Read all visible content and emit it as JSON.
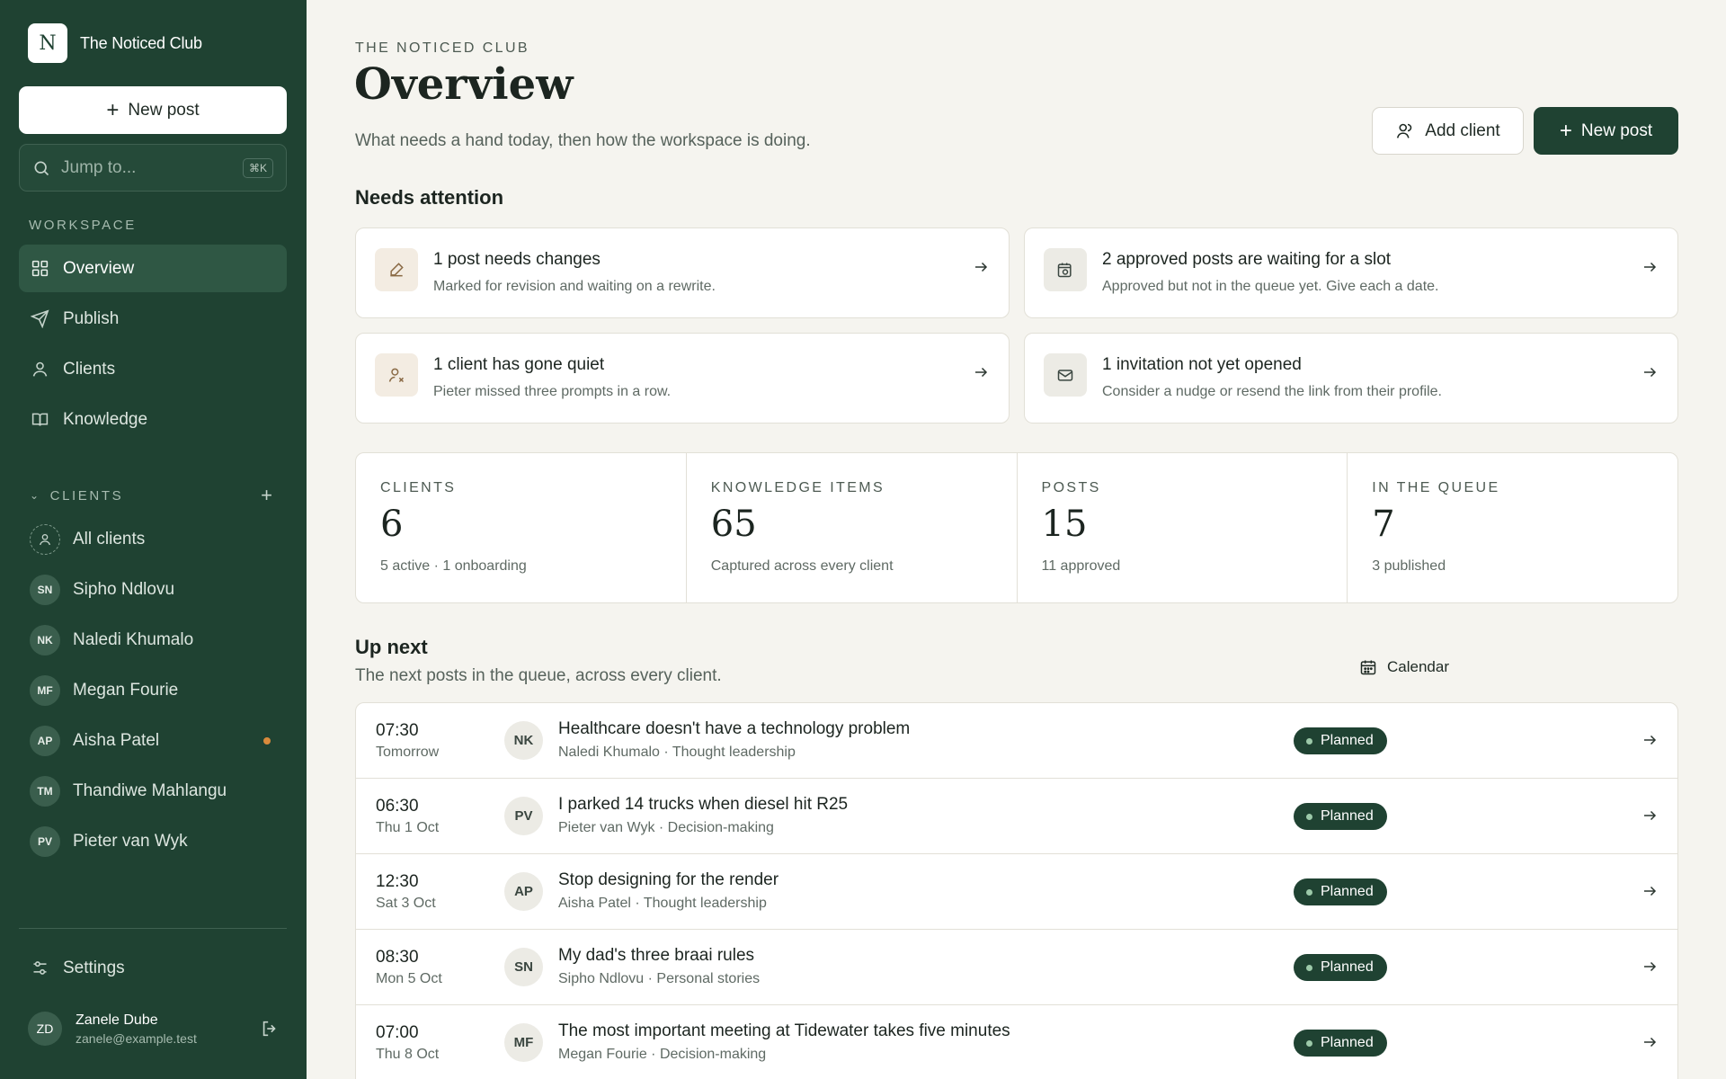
{
  "brand": {
    "initial": "N",
    "name": "The Noticed Club"
  },
  "sidebar": {
    "new_post_label": "New post",
    "search_placeholder": "Jump to...",
    "search_shortcut": "⌘K",
    "workspace_heading": "WORKSPACE",
    "nav": [
      {
        "label": "Overview",
        "icon": "grid-icon",
        "active": true
      },
      {
        "label": "Publish",
        "icon": "send-icon"
      },
      {
        "label": "Clients",
        "icon": "user-icon"
      },
      {
        "label": "Knowledge",
        "icon": "book-icon"
      }
    ],
    "clients_heading": "CLIENTS",
    "clients": [
      {
        "initials": "",
        "name": "All clients"
      },
      {
        "initials": "SN",
        "name": "Sipho Ndlovu"
      },
      {
        "initials": "NK",
        "name": "Naledi Khumalo"
      },
      {
        "initials": "MF",
        "name": "Megan Fourie"
      },
      {
        "initials": "AP",
        "name": "Aisha Patel",
        "flag": true
      },
      {
        "initials": "TM",
        "name": "Thandiwe Mahlangu"
      },
      {
        "initials": "PV",
        "name": "Pieter van Wyk"
      }
    ],
    "settings_label": "Settings",
    "user": {
      "initials": "ZD",
      "name": "Zanele Dube",
      "email": "zanele@example.test"
    }
  },
  "header": {
    "eyebrow": "THE NOTICED CLUB",
    "title": "Overview",
    "subtitle": "What needs a hand today, then how the workspace is doing.",
    "add_client_label": "Add client",
    "new_post_label": "New post"
  },
  "attention": {
    "heading": "Needs attention",
    "cards": [
      {
        "title": "1 post needs changes",
        "desc": "Marked for revision and waiting on a rewrite.",
        "icon": "pencil-icon",
        "tint": "#f3ece2"
      },
      {
        "title": "2 approved posts are waiting for a slot",
        "desc": "Approved but not in the queue yet. Give each a date.",
        "icon": "calendar-clock-icon",
        "tint": "#ecebe5"
      },
      {
        "title": "1 client has gone quiet",
        "desc": "Pieter missed three prompts in a row.",
        "icon": "user-x-icon",
        "tint": "#f3ece2"
      },
      {
        "title": "1 invitation not yet opened",
        "desc": "Consider a nudge or resend the link from their profile.",
        "icon": "mail-icon",
        "tint": "#ecebe5"
      }
    ]
  },
  "stats": [
    {
      "label": "CLIENTS",
      "value": "6",
      "sub": "5 active · 1 onboarding"
    },
    {
      "label": "KNOWLEDGE ITEMS",
      "value": "65",
      "sub": "Captured across every client"
    },
    {
      "label": "POSTS",
      "value": "15",
      "sub": "11 approved"
    },
    {
      "label": "IN THE QUEUE",
      "value": "7",
      "sub": "3 published"
    }
  ],
  "upnext": {
    "heading": "Up next",
    "subtitle": "The next posts in the queue, across every client.",
    "calendar_label": "Calendar",
    "rows": [
      {
        "time": "07:30",
        "day": "Tomorrow",
        "initials": "NK",
        "title": "Healthcare doesn't have a technology problem",
        "meta": "Naledi Khumalo · Thought leadership",
        "status": "Planned"
      },
      {
        "time": "06:30",
        "day": "Thu 1 Oct",
        "initials": "PV",
        "title": "I parked 14 trucks when diesel hit R25",
        "meta": "Pieter van Wyk · Decision-making",
        "status": "Planned"
      },
      {
        "time": "12:30",
        "day": "Sat 3 Oct",
        "initials": "AP",
        "title": "Stop designing for the render",
        "meta": "Aisha Patel · Thought leadership",
        "status": "Planned"
      },
      {
        "time": "08:30",
        "day": "Mon 5 Oct",
        "initials": "SN",
        "title": "My dad's three braai rules",
        "meta": "Sipho Ndlovu · Personal stories",
        "status": "Planned"
      },
      {
        "time": "07:00",
        "day": "Thu 8 Oct",
        "initials": "MF",
        "title": "The most important meeting at Tidewater takes five minutes",
        "meta": "Megan Fourie · Decision-making",
        "status": "Planned"
      }
    ]
  }
}
